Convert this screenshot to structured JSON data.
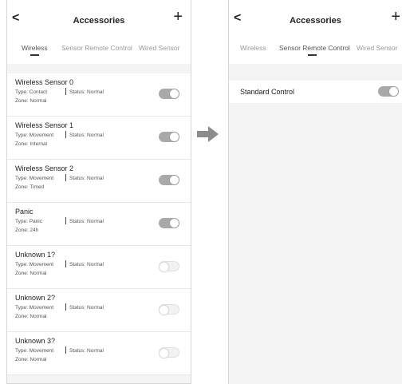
{
  "left": {
    "header": {
      "back_icon": "chevron-left-icon",
      "title": "Accessories",
      "add_icon": "plus-icon"
    },
    "tabs": [
      {
        "label": "Wireless",
        "active": true
      },
      {
        "label": "Sensor Remote Control",
        "active": false
      },
      {
        "label": "Wired Sensor",
        "active": false
      }
    ],
    "devices": [
      {
        "name": "Wireless Sensor 0",
        "type": "Type: Contact",
        "status": "Status: Normal",
        "zone": "Zone: Normal",
        "enabled": true
      },
      {
        "name": "Wireless Sensor 1",
        "type": "Type: Movement",
        "status": "Status: Normal",
        "zone": "Zone: Internal",
        "enabled": true
      },
      {
        "name": "Wireless Sensor 2",
        "type": "Type: Movement",
        "status": "Status: Normal",
        "zone": "Zone: Timed",
        "enabled": true
      },
      {
        "name": "Panic",
        "type": "Type: Panic",
        "status": "Status: Normal",
        "zone": "Zone: 24h",
        "enabled": true
      },
      {
        "name": "Unknown 1?",
        "type": "Type: Movement",
        "status": "Status: Normal",
        "zone": "Zone: Normal",
        "enabled": false
      },
      {
        "name": "Unknown 2?",
        "type": "Type: Movement",
        "status": "Status: Normal",
        "zone": "Zone: Normal",
        "enabled": false
      },
      {
        "name": "Unknown 3?",
        "type": "Type: Movement",
        "status": "Status: Normal",
        "zone": "Zone: Normal",
        "enabled": false
      }
    ]
  },
  "arrow_icon": "arrow-right-icon",
  "right": {
    "header": {
      "back_icon": "chevron-left-icon",
      "title": "Accessories",
      "add_icon": "plus-icon"
    },
    "tabs": [
      {
        "label": "Wireless",
        "active": false
      },
      {
        "label": "Sensor Remote Control",
        "active": true
      },
      {
        "label": "Wired Sensor",
        "active": false
      }
    ],
    "controls": [
      {
        "name": "Standard Control",
        "enabled": true
      }
    ]
  },
  "colors": {
    "toggle_on": "#a9a9a9",
    "toggle_off": "#f2f2f2",
    "background": "#f4f4f4",
    "arrow": "#8c8c8c"
  }
}
